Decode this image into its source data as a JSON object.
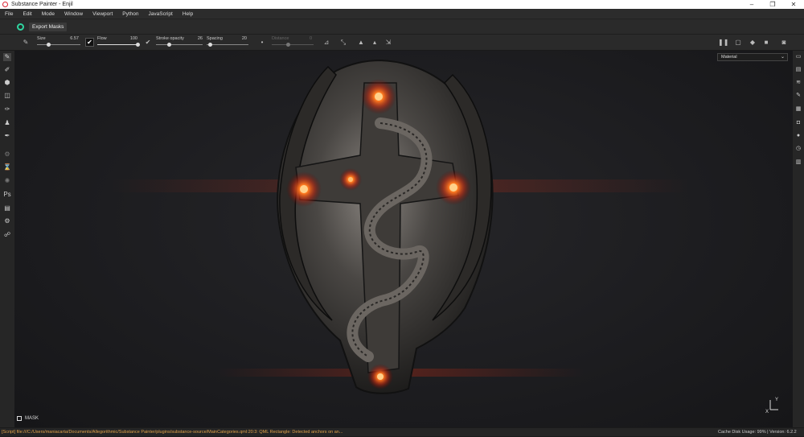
{
  "app": {
    "title": "Substance Painter - Enjil"
  },
  "menu": [
    "File",
    "Edit",
    "Mode",
    "Window",
    "Viewport",
    "Python",
    "JavaScript",
    "Help"
  ],
  "toolbar": {
    "export_label": "Export Masks"
  },
  "brush": {
    "size_label": "Size",
    "size_value": "6.57",
    "flow_label": "Flow",
    "flow_value": "100",
    "opacity_label": "Stroke opacity",
    "opacity_value": "26",
    "spacing_label": "Spacing",
    "spacing_value": "20",
    "distance_label": "Distance",
    "distance_value": "0"
  },
  "viewport": {
    "mode": "Material",
    "mask_label": "MASK",
    "axis_y": "Y",
    "axis_x": "X"
  },
  "status": {
    "message": "[Script] file:///C:/Users/maniacarta/Documents/Allegorithmic/Substance Painter/plugins/substance-source/MainCategories.qml:20:3: QML Rectangle: Detected anchors on an...",
    "cache": "Cache Disk Usage:   99% | Version: 6.2.2"
  },
  "colors": {
    "accent": "#2fd5a0",
    "status_text": "#e0a24a",
    "glow": "#ff5a1e"
  }
}
